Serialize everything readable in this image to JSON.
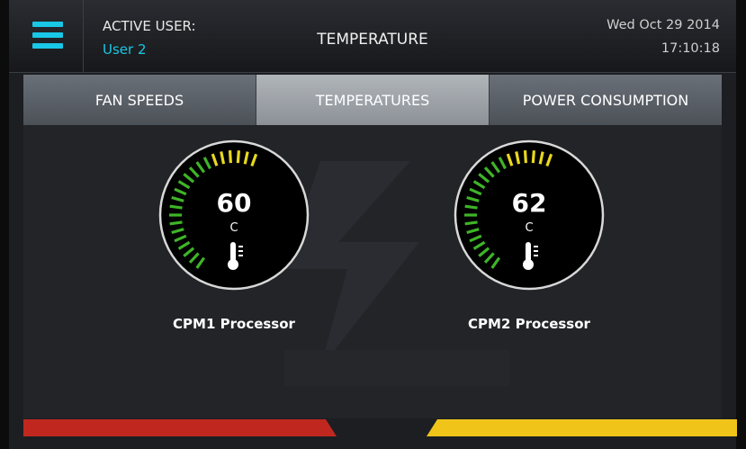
{
  "header": {
    "active_user_label": "ACTIVE USER:",
    "active_user_name": "User 2",
    "title": "TEMPERATURE",
    "date": "Wed Oct 29 2014",
    "time": "17:10:18",
    "menu_icon": "hamburger-menu-icon"
  },
  "tabs": [
    {
      "label": "FAN SPEEDS",
      "active": false
    },
    {
      "label": "TEMPERATURES",
      "active": true
    },
    {
      "label": "POWER CONSUMPTION",
      "active": false
    }
  ],
  "gauges": [
    {
      "value": "60",
      "unit": "C",
      "label": "CPM1 Processor",
      "icon": "thermometer-icon"
    },
    {
      "value": "62",
      "unit": "C",
      "label": "CPM2 Processor",
      "icon": "thermometer-icon"
    }
  ],
  "status_bars": {
    "left_color": "#c0281f",
    "right_color": "#f0c419"
  },
  "colors": {
    "accent": "#19c7e6",
    "gauge_green": "#3fb428",
    "gauge_yellow": "#e8d81e"
  }
}
